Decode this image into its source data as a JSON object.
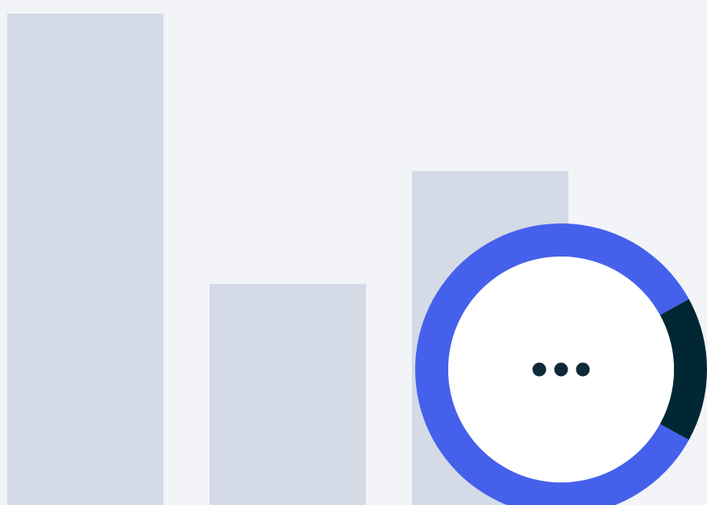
{
  "colors": {
    "background": "#f2f4f8",
    "bar": "#d4dae6",
    "ring_primary": "#4561ec",
    "ring_secondary": "#002733",
    "center": "#ffffff",
    "dots": "#0e2a36"
  },
  "chart_data": [
    {
      "type": "bar",
      "categories": [
        "",
        "",
        ""
      ],
      "values": [
        100,
        45,
        68
      ],
      "ylim": [
        0,
        100
      ],
      "grid": false
    },
    {
      "type": "pie",
      "variant": "donut",
      "slices": [
        {
          "value": 84,
          "color": "#4561ec"
        },
        {
          "value": 16,
          "color": "#002733"
        }
      ],
      "center_icon": "more-horizontal-icon"
    }
  ]
}
